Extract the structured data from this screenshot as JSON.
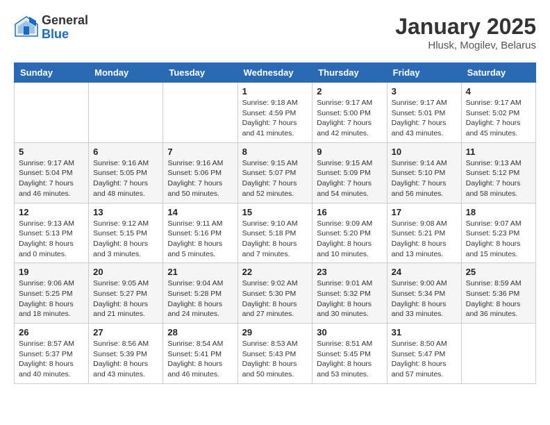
{
  "logo": {
    "general": "General",
    "blue": "Blue"
  },
  "title": "January 2025",
  "subtitle": "Hlusk, Mogilev, Belarus",
  "weekdays": [
    "Sunday",
    "Monday",
    "Tuesday",
    "Wednesday",
    "Thursday",
    "Friday",
    "Saturday"
  ],
  "weeks": [
    [
      {
        "day": "",
        "info": ""
      },
      {
        "day": "",
        "info": ""
      },
      {
        "day": "",
        "info": ""
      },
      {
        "day": "1",
        "info": "Sunrise: 9:18 AM\nSunset: 4:59 PM\nDaylight: 7 hours\nand 41 minutes."
      },
      {
        "day": "2",
        "info": "Sunrise: 9:17 AM\nSunset: 5:00 PM\nDaylight: 7 hours\nand 42 minutes."
      },
      {
        "day": "3",
        "info": "Sunrise: 9:17 AM\nSunset: 5:01 PM\nDaylight: 7 hours\nand 43 minutes."
      },
      {
        "day": "4",
        "info": "Sunrise: 9:17 AM\nSunset: 5:02 PM\nDaylight: 7 hours\nand 45 minutes."
      }
    ],
    [
      {
        "day": "5",
        "info": "Sunrise: 9:17 AM\nSunset: 5:04 PM\nDaylight: 7 hours\nand 46 minutes."
      },
      {
        "day": "6",
        "info": "Sunrise: 9:16 AM\nSunset: 5:05 PM\nDaylight: 7 hours\nand 48 minutes."
      },
      {
        "day": "7",
        "info": "Sunrise: 9:16 AM\nSunset: 5:06 PM\nDaylight: 7 hours\nand 50 minutes."
      },
      {
        "day": "8",
        "info": "Sunrise: 9:15 AM\nSunset: 5:07 PM\nDaylight: 7 hours\nand 52 minutes."
      },
      {
        "day": "9",
        "info": "Sunrise: 9:15 AM\nSunset: 5:09 PM\nDaylight: 7 hours\nand 54 minutes."
      },
      {
        "day": "10",
        "info": "Sunrise: 9:14 AM\nSunset: 5:10 PM\nDaylight: 7 hours\nand 56 minutes."
      },
      {
        "day": "11",
        "info": "Sunrise: 9:13 AM\nSunset: 5:12 PM\nDaylight: 7 hours\nand 58 minutes."
      }
    ],
    [
      {
        "day": "12",
        "info": "Sunrise: 9:13 AM\nSunset: 5:13 PM\nDaylight: 8 hours\nand 0 minutes."
      },
      {
        "day": "13",
        "info": "Sunrise: 9:12 AM\nSunset: 5:15 PM\nDaylight: 8 hours\nand 3 minutes."
      },
      {
        "day": "14",
        "info": "Sunrise: 9:11 AM\nSunset: 5:16 PM\nDaylight: 8 hours\nand 5 minutes."
      },
      {
        "day": "15",
        "info": "Sunrise: 9:10 AM\nSunset: 5:18 PM\nDaylight: 8 hours\nand 7 minutes."
      },
      {
        "day": "16",
        "info": "Sunrise: 9:09 AM\nSunset: 5:20 PM\nDaylight: 8 hours\nand 10 minutes."
      },
      {
        "day": "17",
        "info": "Sunrise: 9:08 AM\nSunset: 5:21 PM\nDaylight: 8 hours\nand 13 minutes."
      },
      {
        "day": "18",
        "info": "Sunrise: 9:07 AM\nSunset: 5:23 PM\nDaylight: 8 hours\nand 15 minutes."
      }
    ],
    [
      {
        "day": "19",
        "info": "Sunrise: 9:06 AM\nSunset: 5:25 PM\nDaylight: 8 hours\nand 18 minutes."
      },
      {
        "day": "20",
        "info": "Sunrise: 9:05 AM\nSunset: 5:27 PM\nDaylight: 8 hours\nand 21 minutes."
      },
      {
        "day": "21",
        "info": "Sunrise: 9:04 AM\nSunset: 5:28 PM\nDaylight: 8 hours\nand 24 minutes."
      },
      {
        "day": "22",
        "info": "Sunrise: 9:02 AM\nSunset: 5:30 PM\nDaylight: 8 hours\nand 27 minutes."
      },
      {
        "day": "23",
        "info": "Sunrise: 9:01 AM\nSunset: 5:32 PM\nDaylight: 8 hours\nand 30 minutes."
      },
      {
        "day": "24",
        "info": "Sunrise: 9:00 AM\nSunset: 5:34 PM\nDaylight: 8 hours\nand 33 minutes."
      },
      {
        "day": "25",
        "info": "Sunrise: 8:59 AM\nSunset: 5:36 PM\nDaylight: 8 hours\nand 36 minutes."
      }
    ],
    [
      {
        "day": "26",
        "info": "Sunrise: 8:57 AM\nSunset: 5:37 PM\nDaylight: 8 hours\nand 40 minutes."
      },
      {
        "day": "27",
        "info": "Sunrise: 8:56 AM\nSunset: 5:39 PM\nDaylight: 8 hours\nand 43 minutes."
      },
      {
        "day": "28",
        "info": "Sunrise: 8:54 AM\nSunset: 5:41 PM\nDaylight: 8 hours\nand 46 minutes."
      },
      {
        "day": "29",
        "info": "Sunrise: 8:53 AM\nSunset: 5:43 PM\nDaylight: 8 hours\nand 50 minutes."
      },
      {
        "day": "30",
        "info": "Sunrise: 8:51 AM\nSunset: 5:45 PM\nDaylight: 8 hours\nand 53 minutes."
      },
      {
        "day": "31",
        "info": "Sunrise: 8:50 AM\nSunset: 5:47 PM\nDaylight: 8 hours\nand 57 minutes."
      },
      {
        "day": "",
        "info": ""
      }
    ]
  ]
}
